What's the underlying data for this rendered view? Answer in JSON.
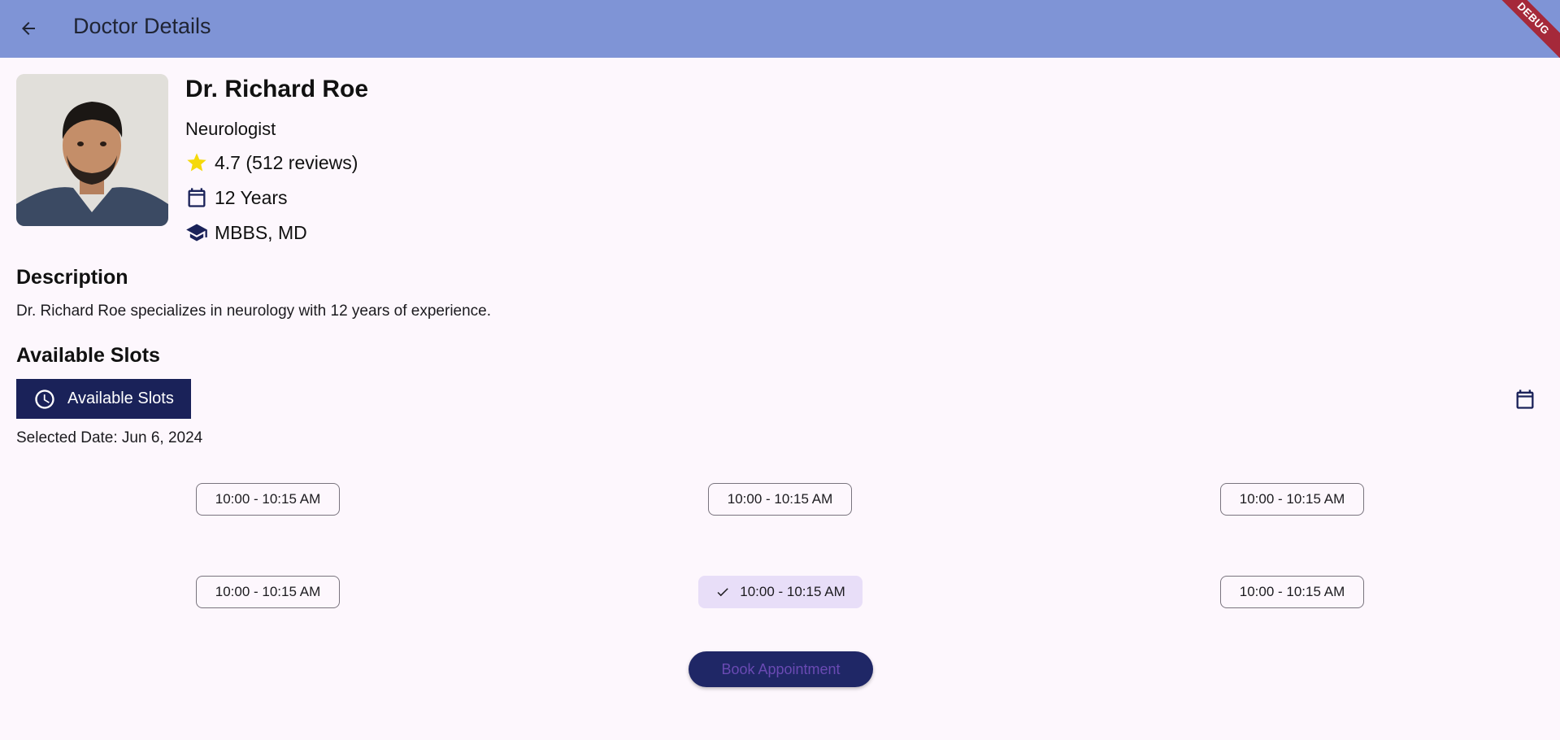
{
  "appbar": {
    "title": "Doctor Details",
    "debug_label": "DEBUG"
  },
  "doctor": {
    "name": "Dr. Richard Roe",
    "specialty": "Neurologist",
    "rating": "4.7 (512 reviews)",
    "experience": "12 Years",
    "qualifications": "MBBS, MD"
  },
  "description": {
    "title": "Description",
    "text": "Dr. Richard Roe specializes in neurology with 12 years of experience."
  },
  "slots": {
    "title": "Available Slots",
    "button_label": "Available Slots",
    "selected_date": "Selected Date: Jun 6, 2024",
    "items": [
      {
        "label": "10:00 - 10:15 AM",
        "selected": false
      },
      {
        "label": "10:00 - 10:15 AM",
        "selected": false
      },
      {
        "label": "10:00 - 10:15 AM",
        "selected": false
      },
      {
        "label": "10:00 - 10:15 AM",
        "selected": false
      },
      {
        "label": "10:00 - 10:15 AM",
        "selected": true
      },
      {
        "label": "10:00 - 10:15 AM",
        "selected": false
      }
    ]
  },
  "book_button": {
    "label": "Book Appointment"
  },
  "colors": {
    "appbar": "#7f94d6",
    "primary_dark": "#1a2259",
    "star": "#f5d90a",
    "selected_chip": "#e8def8",
    "background": "#fdf7fd"
  }
}
